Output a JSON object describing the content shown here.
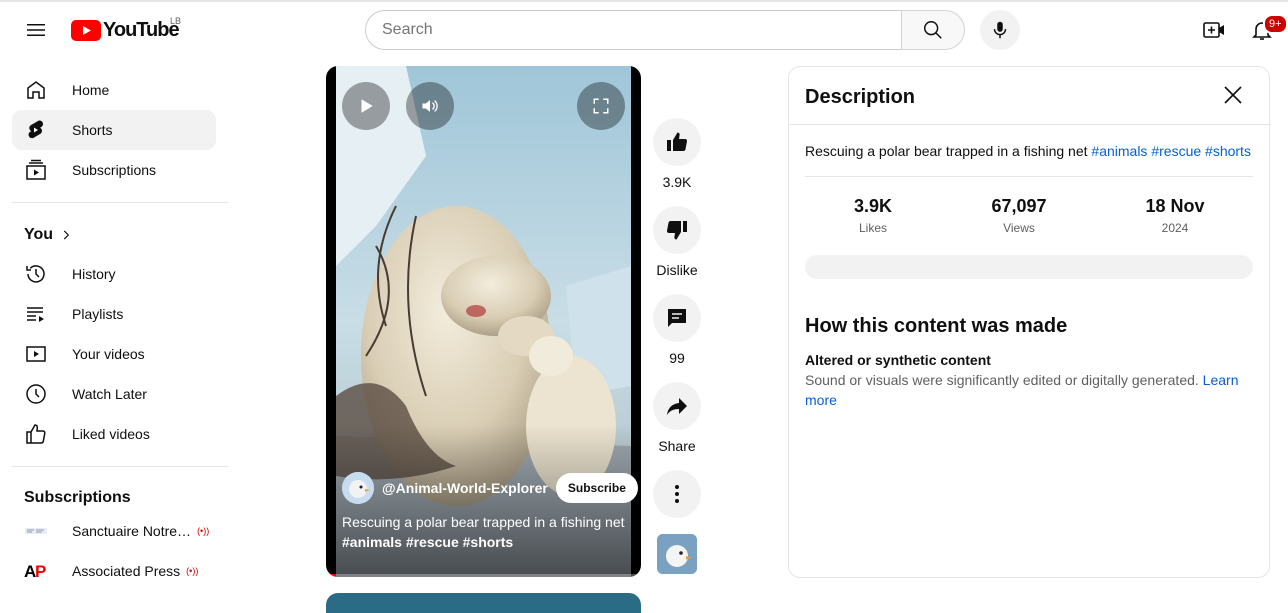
{
  "header": {
    "logo_text": "YouTube",
    "country_code": "LB",
    "search_placeholder": "Search",
    "notification_count": "9+"
  },
  "sidebar": {
    "main_items": [
      {
        "label": "Home",
        "icon": "home-icon"
      },
      {
        "label": "Shorts",
        "icon": "shorts-icon",
        "active": true
      },
      {
        "label": "Subscriptions",
        "icon": "subscriptions-icon"
      }
    ],
    "you_heading": "You",
    "you_items": [
      {
        "label": "History",
        "icon": "history-icon"
      },
      {
        "label": "Playlists",
        "icon": "playlists-icon"
      },
      {
        "label": "Your videos",
        "icon": "your-videos-icon"
      },
      {
        "label": "Watch Later",
        "icon": "watch-later-icon"
      },
      {
        "label": "Liked videos",
        "icon": "liked-videos-icon"
      }
    ],
    "subscriptions_heading": "Subscriptions",
    "subscriptions": [
      {
        "label": "Sanctuaire Notre…",
        "live": "(•))"
      },
      {
        "label": "Associated Press",
        "live": "(•))"
      }
    ]
  },
  "video": {
    "channel_name": "@Animal-World-Explorer",
    "subscribe_label": "Subscribe",
    "title": "Rescuing a polar bear trapped in a fishing net",
    "tags": "#animals #rescue #shorts",
    "progress": 0.03
  },
  "actions": {
    "like_count": "3.9K",
    "dislike_label": "Dislike",
    "comment_count": "99",
    "share_label": "Share"
  },
  "description_panel": {
    "title": "Description",
    "text": "Rescuing a polar bear trapped in a fishing net",
    "hashtags": [
      "#animals",
      "#rescue",
      "#shorts"
    ],
    "stats": [
      {
        "value": "3.9K",
        "caption": "Likes"
      },
      {
        "value": "67,097",
        "caption": "Views"
      },
      {
        "value": "18 Nov",
        "caption": "2024"
      }
    ],
    "how_made_title": "How this content was made",
    "altered_title": "Altered or synthetic content",
    "altered_text": "Sound or visuals were significantly edited or digitally generated.",
    "learn_more": "Learn more"
  },
  "colors": {
    "brand_red": "#ff0000",
    "link_blue": "#065fd4",
    "live_red": "#cc0000"
  }
}
